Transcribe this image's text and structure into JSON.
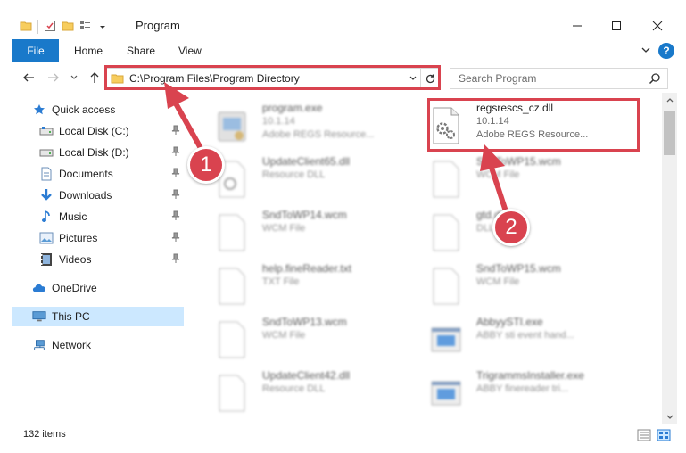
{
  "window": {
    "title": "Program",
    "controls": {
      "minimize": "minimize-icon",
      "maximize": "maximize-icon",
      "close": "close-icon"
    }
  },
  "ribbon": {
    "file_tab": "File",
    "tabs": [
      "Home",
      "Share",
      "View"
    ]
  },
  "address": {
    "path": "C:\\Program Files\\Program Directory"
  },
  "search": {
    "placeholder": "Search Program"
  },
  "nav": {
    "items": [
      {
        "label": "Quick access",
        "icon": "star-icon"
      },
      {
        "label": "Local Disk (C:)",
        "icon": "drive-icon",
        "pinned": true
      },
      {
        "label": "Local Disk (D:)",
        "icon": "drive-icon",
        "pinned": true
      },
      {
        "label": "Documents",
        "icon": "documents-icon",
        "pinned": true
      },
      {
        "label": "Downloads",
        "icon": "downloads-icon",
        "pinned": true
      },
      {
        "label": "Music",
        "icon": "music-icon",
        "pinned": true
      },
      {
        "label": "Pictures",
        "icon": "pictures-icon",
        "pinned": true
      },
      {
        "label": "Videos",
        "icon": "videos-icon",
        "pinned": true
      },
      {
        "label": "OneDrive",
        "icon": "cloud-icon"
      },
      {
        "label": "This PC",
        "icon": "computer-icon",
        "selected": true
      },
      {
        "label": "Network",
        "icon": "network-icon"
      }
    ]
  },
  "files": {
    "left": [
      {
        "name": "program.exe",
        "line1": "10.1.14",
        "line2": "Adobe REGS Resource...",
        "kind": "exe"
      },
      {
        "name": "UpdateClient65.dll",
        "line1": "Resource DLL",
        "line2": "",
        "kind": "dll"
      },
      {
        "name": "SndToWP14.wcm",
        "line1": "WCM File",
        "line2": "",
        "kind": "blank"
      },
      {
        "name": "help.fineReader.txt",
        "line1": "TXT File",
        "line2": "",
        "kind": "blank"
      },
      {
        "name": "SndToWP13.wcm",
        "line1": "WCM File",
        "line2": "",
        "kind": "blank"
      },
      {
        "name": "UpdateClient42.dll",
        "line1": "Resource DLL",
        "line2": "",
        "kind": "dll"
      }
    ],
    "right": [
      {
        "name": "regsrescs_cz.dll",
        "line1": "10.1.14",
        "line2": "Adobe REGS Resource...",
        "kind": "dll"
      },
      {
        "name": "SndToWP15.wcm",
        "line1": "WCM File",
        "line2": "",
        "kind": "blank"
      },
      {
        "name": "gtd.dll",
        "line1": "DLL File",
        "line2": "",
        "kind": "blank"
      },
      {
        "name": "SndToWP15.wcm",
        "line1": "WCM File",
        "line2": "",
        "kind": "blank"
      },
      {
        "name": "AbbyySTI.exe",
        "line1": "ABBY sti event hand...",
        "line2": "",
        "kind": "app"
      },
      {
        "name": "TrigrammsInstaller.exe",
        "line1": "ABBY finereader tri...",
        "line2": "",
        "kind": "app"
      }
    ]
  },
  "status": {
    "items_count": "132 items"
  },
  "annotations": {
    "step1": "1",
    "step2": "2",
    "color": "#d9434f"
  },
  "colors": {
    "accent": "#1979ca",
    "selection": "#cce8ff"
  }
}
